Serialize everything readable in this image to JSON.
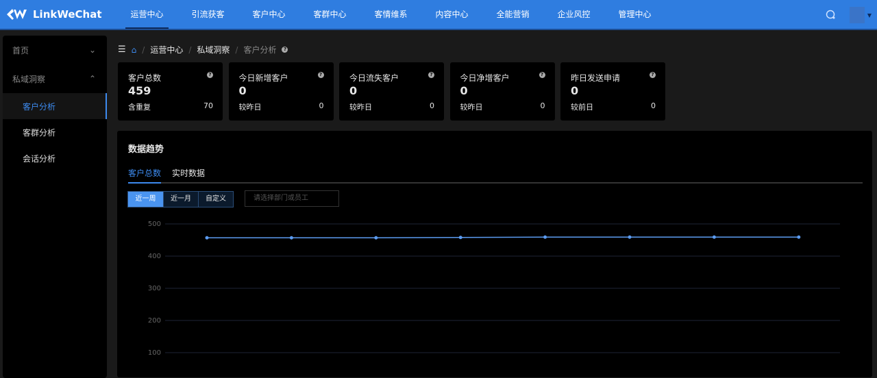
{
  "header": {
    "logo": "LinkWeChat",
    "nav": [
      "运营中心",
      "引流获客",
      "客户中心",
      "客群中心",
      "客情维系",
      "内容中心",
      "全能营销",
      "企业风控",
      "管理中心"
    ],
    "active": 0
  },
  "sidebar": {
    "items": [
      {
        "label": "首页"
      },
      {
        "label": "私域洞察"
      }
    ],
    "sub": [
      "客户分析",
      "客群分析",
      "会话分析"
    ]
  },
  "breadcrumb": [
    "运营中心",
    "私域洞察",
    "客户分析"
  ],
  "cards": [
    {
      "title": "客户总数",
      "value": "459",
      "foot": "含重复",
      "footval": "70"
    },
    {
      "title": "今日新增客户",
      "value": "0",
      "foot": "较昨日",
      "footval": "0"
    },
    {
      "title": "今日流失客户",
      "value": "0",
      "foot": "较昨日",
      "footval": "0"
    },
    {
      "title": "今日净增客户",
      "value": "0",
      "foot": "较昨日",
      "footval": "0"
    },
    {
      "title": "昨日发送申请",
      "value": "0",
      "foot": "较前日",
      "footval": "0"
    }
  ],
  "panel": {
    "title": "数据趋势",
    "tabs": [
      "客户总数",
      "实时数据"
    ],
    "ranges": [
      "近一周",
      "近一月",
      "自定义"
    ],
    "placeholder": "请选择部门或员工"
  },
  "chart_data": {
    "type": "line",
    "y": [
      457,
      457,
      457,
      458,
      459,
      459,
      459,
      459
    ],
    "yticks": [
      100,
      200,
      300,
      400,
      500
    ],
    "ylim": [
      0,
      500
    ],
    "color": "#5b9bf0"
  }
}
